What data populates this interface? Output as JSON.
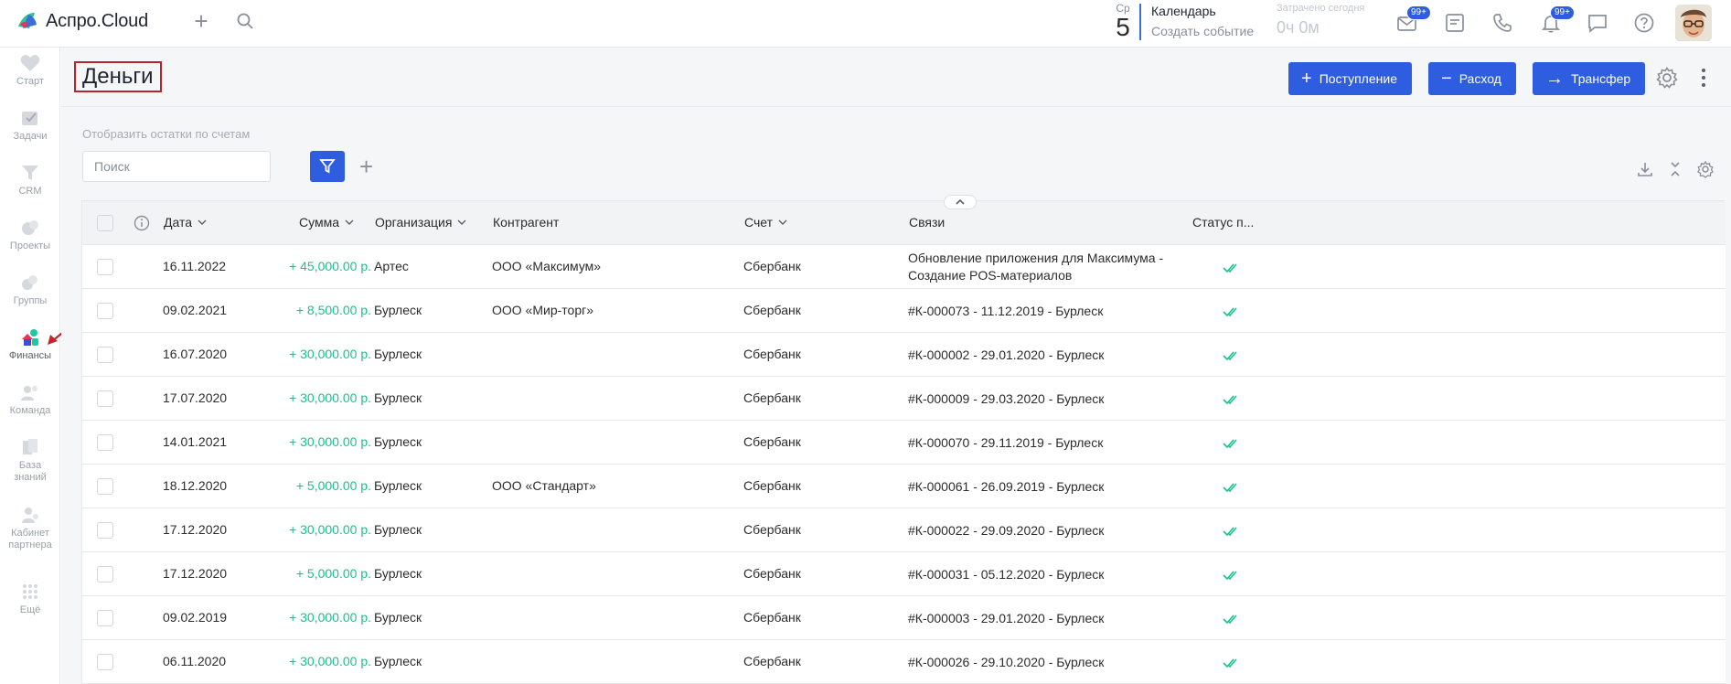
{
  "topbar": {
    "logo_text": "Аспро.Cloud",
    "plus_icon": "plus-icon",
    "search_icon": "search-icon",
    "calendar": {
      "weekday": "Ср",
      "day": "5",
      "title": "Календарь",
      "action": "Создать событие"
    },
    "spent": {
      "label": "Затрачено сегодня",
      "value": "0ч 0м"
    },
    "mail_badge": "99+",
    "notif_badge": "99+"
  },
  "sidebar": {
    "items": [
      {
        "label": "Старт",
        "icon": "heart-icon"
      },
      {
        "label": "Задачи",
        "icon": "tasks-icon"
      },
      {
        "label": "CRM",
        "icon": "crm-icon"
      },
      {
        "label": "Проекты",
        "icon": "projects-icon"
      },
      {
        "label": "Группы",
        "icon": "groups-icon"
      },
      {
        "label": "Финансы",
        "icon": "finance-icon"
      },
      {
        "label": "Команда",
        "icon": "team-icon"
      },
      {
        "label": "База знаний",
        "label_l1": "База",
        "label_l2": "знаний",
        "icon": "knowledge-icon"
      },
      {
        "label": "Кабинет партнера",
        "label_l1": "Кабинет",
        "label_l2": "партнера",
        "icon": "partner-icon"
      },
      {
        "label": "Ещё",
        "icon": "more-icon"
      }
    ]
  },
  "page": {
    "title": "Деньги",
    "buttons": {
      "income": "Поступление",
      "expense": "Расход",
      "transfer": "Трансфер"
    }
  },
  "filters": {
    "balance_link": "Отобразить остатки по счетам",
    "search_placeholder": "Поиск"
  },
  "table": {
    "columns": {
      "date": "Дата",
      "amount": "Сумма",
      "org": "Организация",
      "counterparty": "Контрагент",
      "account": "Счет",
      "links": "Связи",
      "status": "Статус п..."
    },
    "rows": [
      {
        "date": "16.11.2022",
        "amount": "+ 45,000.00 р.",
        "org": "Артес",
        "counterparty": "ООО «Максимум»",
        "account": "Сбербанк",
        "links": "Обновление приложения для Максимума - Создание POS-материалов"
      },
      {
        "date": "09.02.2021",
        "amount": "+ 8,500.00 р.",
        "org": "Бурлеск",
        "counterparty": "ООО «Мир-торг»",
        "account": "Сбербанк",
        "links": "#К-000073 - 11.12.2019 - Бурлеск"
      },
      {
        "date": "16.07.2020",
        "amount": "+ 30,000.00 р.",
        "org": "Бурлеск",
        "counterparty": "",
        "account": "Сбербанк",
        "links": "#К-000002 - 29.01.2020 - Бурлеск"
      },
      {
        "date": "17.07.2020",
        "amount": "+ 30,000.00 р.",
        "org": "Бурлеск",
        "counterparty": "",
        "account": "Сбербанк",
        "links": "#К-000009 - 29.03.2020 - Бурлеск"
      },
      {
        "date": "14.01.2021",
        "amount": "+ 30,000.00 р.",
        "org": "Бурлеск",
        "counterparty": "",
        "account": "Сбербанк",
        "links": "#К-000070 - 29.11.2019 - Бурлеск"
      },
      {
        "date": "18.12.2020",
        "amount": "+ 5,000.00 р.",
        "org": "Бурлеск",
        "counterparty": "ООО «Стандарт»",
        "account": "Сбербанк",
        "links": "#К-000061 - 26.09.2019 - Бурлеск"
      },
      {
        "date": "17.12.2020",
        "amount": "+ 30,000.00 р.",
        "org": "Бурлеск",
        "counterparty": "",
        "account": "Сбербанк",
        "links": "#К-000022 - 29.09.2020 - Бурлеск"
      },
      {
        "date": "17.12.2020",
        "amount": "+ 5,000.00 р.",
        "org": "Бурлеск",
        "counterparty": "",
        "account": "Сбербанк",
        "links": "#К-000031 - 05.12.2020 - Бурлеск"
      },
      {
        "date": "09.02.2019",
        "amount": "+ 30,000.00 р.",
        "org": "Бурлеск",
        "counterparty": "",
        "account": "Сбербанк",
        "links": "#К-000003 - 29.01.2020 - Бурлеск"
      },
      {
        "date": "06.11.2020",
        "amount": "+ 30,000.00 р.",
        "org": "Бурлеск",
        "counterparty": "",
        "account": "Сбербанк",
        "links": "#К-000026 - 29.10.2020 - Бурлеск"
      }
    ]
  },
  "colors": {
    "accent": "#2f5de0",
    "amount": "#19c28c",
    "title_border": "#b3262d",
    "status_check": "#19c28c"
  }
}
